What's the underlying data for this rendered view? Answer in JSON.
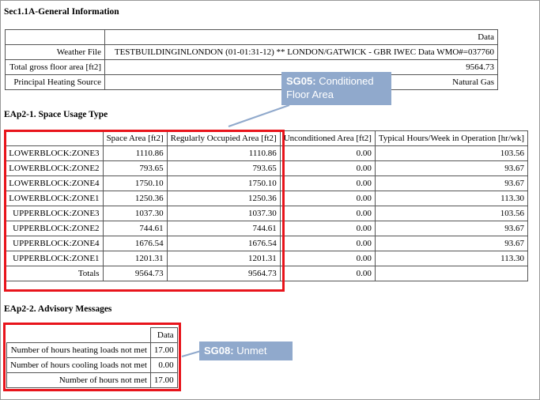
{
  "sec1": {
    "heading": "Sec1.1A-General Information",
    "col_header": "Data",
    "rows": [
      {
        "label": "Weather File",
        "value": "TESTBUILDINGINLONDON (01-01:31-12) ** LONDON/GATWICK - GBR IWEC Data WMO#=037760"
      },
      {
        "label": "Total gross floor area [ft2]",
        "value": "9564.73"
      },
      {
        "label": "Principal Heating Source",
        "value": "Natural Gas"
      }
    ]
  },
  "callout_sg05": {
    "code": "SG05:",
    "text": "Conditioned",
    "text2": "Floor Area"
  },
  "eap21": {
    "heading": "EAp2-1. Space Usage Type",
    "headers": [
      "",
      "Space Area [ft2]",
      "Regularly Occupied Area [ft2]",
      "Unconditioned Area [ft2]",
      "Typical Hours/Week in Operation [hr/wk]"
    ],
    "rows": [
      [
        "LOWERBLOCK:ZONE3",
        "1110.86",
        "1110.86",
        "0.00",
        "103.56"
      ],
      [
        "LOWERBLOCK:ZONE2",
        "793.65",
        "793.65",
        "0.00",
        "93.67"
      ],
      [
        "LOWERBLOCK:ZONE4",
        "1750.10",
        "1750.10",
        "0.00",
        "93.67"
      ],
      [
        "LOWERBLOCK:ZONE1",
        "1250.36",
        "1250.36",
        "0.00",
        "113.30"
      ],
      [
        "UPPERBLOCK:ZONE3",
        "1037.30",
        "1037.30",
        "0.00",
        "103.56"
      ],
      [
        "UPPERBLOCK:ZONE2",
        "744.61",
        "744.61",
        "0.00",
        "93.67"
      ],
      [
        "UPPERBLOCK:ZONE4",
        "1676.54",
        "1676.54",
        "0.00",
        "93.67"
      ],
      [
        "UPPERBLOCK:ZONE1",
        "1201.31",
        "1201.31",
        "0.00",
        "113.30"
      ],
      [
        "Totals",
        "9564.73",
        "9564.73",
        "0.00",
        ""
      ]
    ]
  },
  "eap22": {
    "heading": "EAp2-2. Advisory Messages",
    "col_header": "Data",
    "rows": [
      {
        "label": "Number of hours heating loads not met",
        "value": "17.00"
      },
      {
        "label": "Number of hours cooling loads not met",
        "value": "0.00"
      },
      {
        "label": "Number of hours not met",
        "value": "17.00"
      }
    ]
  },
  "callout_sg08": {
    "code": "SG08:",
    "text": "Unmet"
  },
  "colors": {
    "highlight": "#e8141b",
    "callout_bg": "#90a9cc",
    "callout_line": "#90a9cc"
  }
}
